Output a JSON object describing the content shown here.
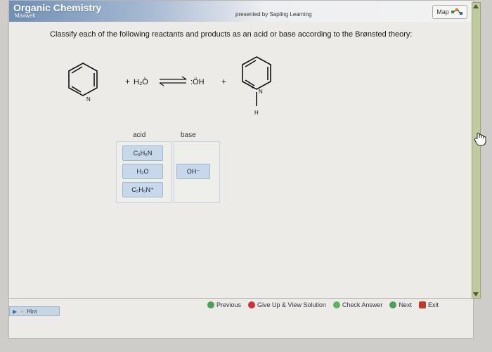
{
  "header": {
    "app_title": "Organic Chemistry",
    "author": "Maxwell",
    "presented_by": "presented by Sapling Learning",
    "map_label": "Map"
  },
  "question": "Classify each of the following reactants and products as an acid or base according to the Brønsted theory:",
  "reaction": {
    "plus1": "+",
    "water": "H₂Ö",
    "hydroxide": ":ÖH",
    "plus2": "+",
    "n_label": "N",
    "n_plus_label": "N",
    "plus_sign": "+",
    "h_label": "H"
  },
  "classify": {
    "acid_header": "acid",
    "base_header": "base",
    "acid_items": [
      "C₅H₅N",
      "H₂O",
      "C₅H₆N⁺"
    ],
    "base_items": [
      "OH⁻"
    ]
  },
  "footer": {
    "previous": "Previous",
    "give_up": "Give Up & View Solution",
    "check": "Check Answer",
    "next": "Next",
    "exit": "Exit",
    "hint": "Hint"
  }
}
